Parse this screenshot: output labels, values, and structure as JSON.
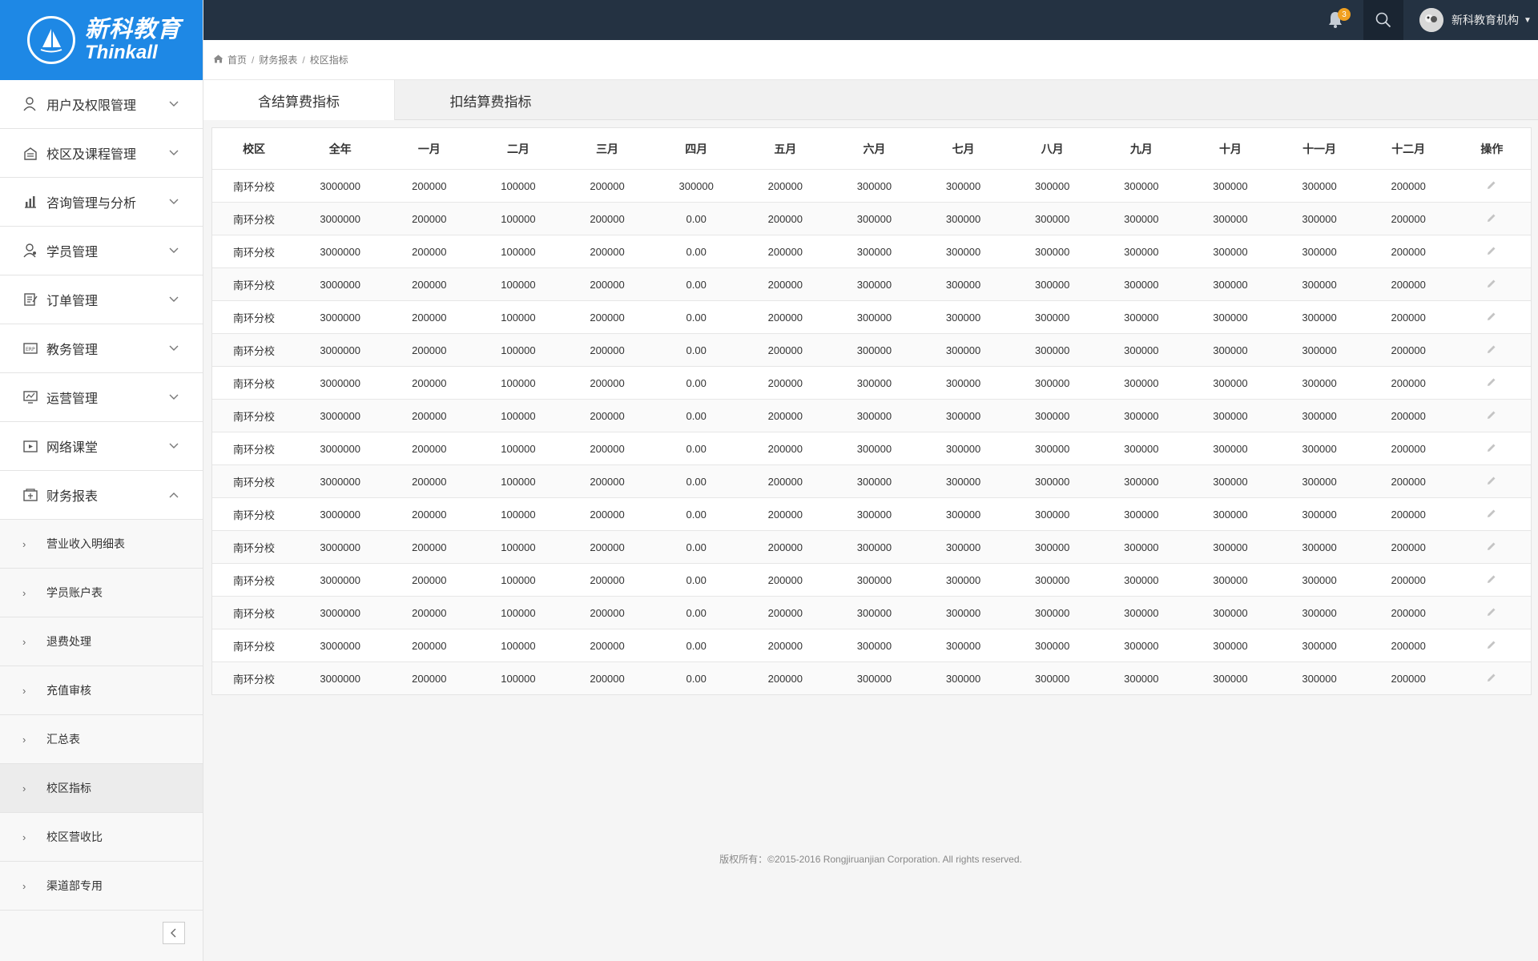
{
  "brand": {
    "name_cn": "新科教育",
    "name_en": "Thinkall"
  },
  "sidebar": {
    "items": [
      {
        "label": "用户及权限管理",
        "icon": "user-icon",
        "expanded": false
      },
      {
        "label": "校区及课程管理",
        "icon": "building-icon",
        "expanded": false
      },
      {
        "label": "咨询管理与分析",
        "icon": "bar-chart-icon",
        "expanded": false
      },
      {
        "label": "学员管理",
        "icon": "student-icon",
        "expanded": false
      },
      {
        "label": "订单管理",
        "icon": "order-icon",
        "expanded": false
      },
      {
        "label": "教务管理",
        "icon": "erp-icon",
        "expanded": false
      },
      {
        "label": "运营管理",
        "icon": "monitor-chart-icon",
        "expanded": false
      },
      {
        "label": "网络课堂",
        "icon": "video-icon",
        "expanded": false
      },
      {
        "label": "财务报表",
        "icon": "finance-icon",
        "expanded": true
      }
    ],
    "finance_submenu": [
      {
        "label": "营业收入明细表",
        "active": false
      },
      {
        "label": "学员账户表",
        "active": false
      },
      {
        "label": "退费处理",
        "active": false
      },
      {
        "label": "充值审核",
        "active": false
      },
      {
        "label": "汇总表",
        "active": false
      },
      {
        "label": "校区指标",
        "active": true
      },
      {
        "label": "校区营收比",
        "active": false
      },
      {
        "label": "渠道部专用",
        "active": false
      }
    ]
  },
  "topbar": {
    "notification_count": "3",
    "user_name": "新科教育机构"
  },
  "breadcrumb": [
    "首页",
    "财务报表",
    "校区指标"
  ],
  "tabs": [
    {
      "label": "含结算费指标",
      "active": true
    },
    {
      "label": "扣结算费指标",
      "active": false
    }
  ],
  "table": {
    "headers": [
      "校区",
      "全年",
      "一月",
      "二月",
      "三月",
      "四月",
      "五月",
      "六月",
      "七月",
      "八月",
      "九月",
      "十月",
      "十一月",
      "十二月",
      "操作"
    ],
    "rows": [
      [
        "南环分校",
        "3000000",
        "200000",
        "100000",
        "200000",
        "300000",
        "200000",
        "300000",
        "300000",
        "300000",
        "300000",
        "300000",
        "300000",
        "200000"
      ],
      [
        "南环分校",
        "3000000",
        "200000",
        "100000",
        "200000",
        "0.00",
        "200000",
        "300000",
        "300000",
        "300000",
        "300000",
        "300000",
        "300000",
        "200000"
      ],
      [
        "南环分校",
        "3000000",
        "200000",
        "100000",
        "200000",
        "0.00",
        "200000",
        "300000",
        "300000",
        "300000",
        "300000",
        "300000",
        "300000",
        "200000"
      ],
      [
        "南环分校",
        "3000000",
        "200000",
        "100000",
        "200000",
        "0.00",
        "200000",
        "300000",
        "300000",
        "300000",
        "300000",
        "300000",
        "300000",
        "200000"
      ],
      [
        "南环分校",
        "3000000",
        "200000",
        "100000",
        "200000",
        "0.00",
        "200000",
        "300000",
        "300000",
        "300000",
        "300000",
        "300000",
        "300000",
        "200000"
      ],
      [
        "南环分校",
        "3000000",
        "200000",
        "100000",
        "200000",
        "0.00",
        "200000",
        "300000",
        "300000",
        "300000",
        "300000",
        "300000",
        "300000",
        "200000"
      ],
      [
        "南环分校",
        "3000000",
        "200000",
        "100000",
        "200000",
        "0.00",
        "200000",
        "300000",
        "300000",
        "300000",
        "300000",
        "300000",
        "300000",
        "200000"
      ],
      [
        "南环分校",
        "3000000",
        "200000",
        "100000",
        "200000",
        "0.00",
        "200000",
        "300000",
        "300000",
        "300000",
        "300000",
        "300000",
        "300000",
        "200000"
      ],
      [
        "南环分校",
        "3000000",
        "200000",
        "100000",
        "200000",
        "0.00",
        "200000",
        "300000",
        "300000",
        "300000",
        "300000",
        "300000",
        "300000",
        "200000"
      ],
      [
        "南环分校",
        "3000000",
        "200000",
        "100000",
        "200000",
        "0.00",
        "200000",
        "300000",
        "300000",
        "300000",
        "300000",
        "300000",
        "300000",
        "200000"
      ],
      [
        "南环分校",
        "3000000",
        "200000",
        "100000",
        "200000",
        "0.00",
        "200000",
        "300000",
        "300000",
        "300000",
        "300000",
        "300000",
        "300000",
        "200000"
      ],
      [
        "南环分校",
        "3000000",
        "200000",
        "100000",
        "200000",
        "0.00",
        "200000",
        "300000",
        "300000",
        "300000",
        "300000",
        "300000",
        "300000",
        "200000"
      ],
      [
        "南环分校",
        "3000000",
        "200000",
        "100000",
        "200000",
        "0.00",
        "200000",
        "300000",
        "300000",
        "300000",
        "300000",
        "300000",
        "300000",
        "200000"
      ],
      [
        "南环分校",
        "3000000",
        "200000",
        "100000",
        "200000",
        "0.00",
        "200000",
        "300000",
        "300000",
        "300000",
        "300000",
        "300000",
        "300000",
        "200000"
      ],
      [
        "南环分校",
        "3000000",
        "200000",
        "100000",
        "200000",
        "0.00",
        "200000",
        "300000",
        "300000",
        "300000",
        "300000",
        "300000",
        "300000",
        "200000"
      ],
      [
        "南环分校",
        "3000000",
        "200000",
        "100000",
        "200000",
        "0.00",
        "200000",
        "300000",
        "300000",
        "300000",
        "300000",
        "300000",
        "300000",
        "200000"
      ]
    ]
  },
  "footer": {
    "copyright": "版权所有：©2015-2016 Rongjiruanjian Corporation. All rights reserved."
  },
  "colors": {
    "brand_blue": "#1e88e5",
    "topbar": "#243242",
    "badge": "#f0a020"
  }
}
